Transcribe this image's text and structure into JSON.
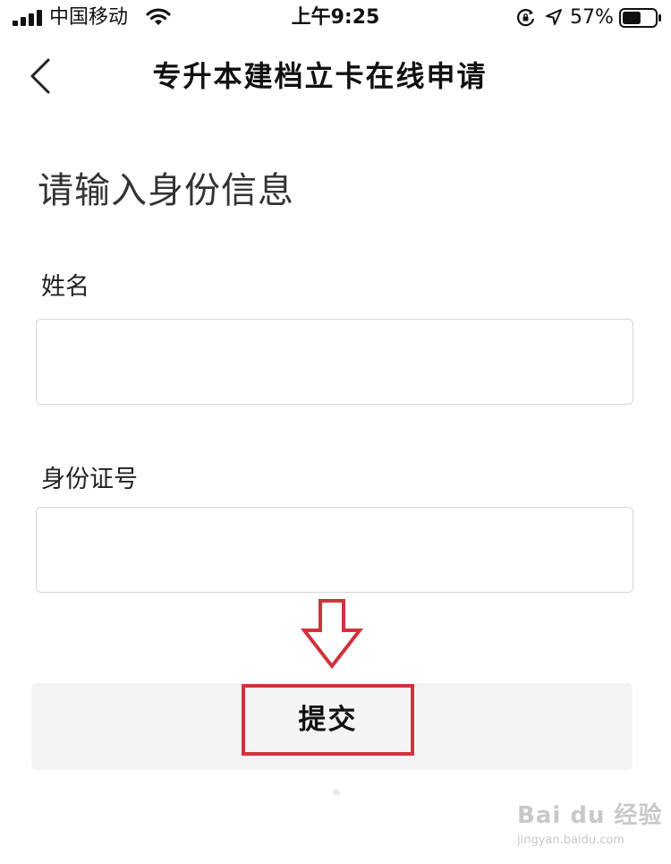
{
  "status_bar": {
    "carrier": "中国移动",
    "time": "上午9:25",
    "battery_percent": "57%",
    "battery_level": 0.57,
    "icons": [
      "signal-icon",
      "wifi-icon",
      "rotation-lock-icon",
      "location-icon",
      "battery-icon"
    ]
  },
  "nav": {
    "title": "专升本建档立卡在线申请",
    "back_icon": "chevron-left-icon"
  },
  "form": {
    "heading": "请输入身份信息",
    "fields": [
      {
        "label": "姓名",
        "value": "",
        "placeholder": ""
      },
      {
        "label": "身份证号",
        "value": "",
        "placeholder": ""
      }
    ],
    "submit_label": "提交"
  },
  "annotation": {
    "arrow_icon": "down-arrow-icon",
    "highlight_color": "#d0333d"
  },
  "watermark": {
    "logo": "Bai du 经验",
    "url": "jingyan.baidu.com"
  }
}
